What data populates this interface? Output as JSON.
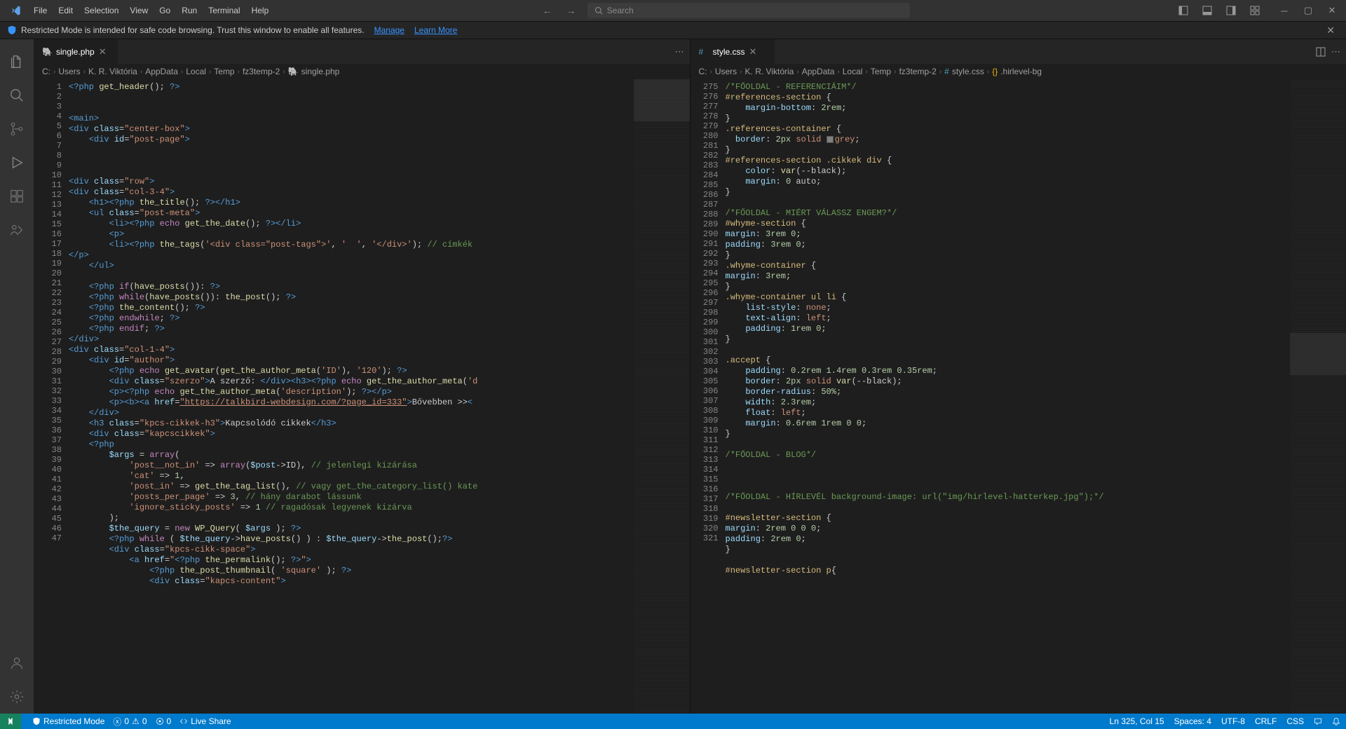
{
  "menubar": [
    "File",
    "Edit",
    "Selection",
    "View",
    "Go",
    "Run",
    "Terminal",
    "Help"
  ],
  "search_placeholder": "Search",
  "notif": {
    "text": "Restricted Mode is intended for safe code browsing. Trust this window to enable all features.",
    "manage": "Manage",
    "learn": "Learn More"
  },
  "tabs": {
    "left": {
      "name": "single.php"
    },
    "right": {
      "name": "style.css"
    }
  },
  "breadcrumbs_left": [
    "C:",
    "Users",
    "K. R. Viktória",
    "AppData",
    "Local",
    "Temp",
    "fz3temp-2",
    "single.php"
  ],
  "breadcrumbs_right": [
    "C:",
    "Users",
    "K. R. Viktória",
    "AppData",
    "Local",
    "Temp",
    "fz3temp-2",
    "style.css",
    ".hirlevel-bg"
  ],
  "left_lines_start": 1,
  "left_lines_end": 47,
  "right_lines_start": 275,
  "right_lines_end": 321,
  "statusbar": {
    "restricted": "Restricted Mode",
    "errors": "0",
    "warnings": "0",
    "ports": "0",
    "liveshare": "Live Share",
    "lncol": "Ln 325, Col 15",
    "spaces": "Spaces: 4",
    "encoding": "UTF-8",
    "eol": "CRLF",
    "lang": "CSS"
  },
  "left_code_html": "<span class='tk-tag'>&lt;?php</span> <span class='tk-fn'>get_header</span>(); <span class='tk-tag'>?&gt;</span>\n\n\n<span class='tk-tag'>&lt;main&gt;</span>\n<span class='tk-tag'>&lt;div</span> <span class='tk-attr'>class</span>=<span class='tk-str'>\"center-box\"</span><span class='tk-tag'>&gt;</span>\n    <span class='tk-tag'>&lt;div</span> <span class='tk-attr'>id</span>=<span class='tk-str'>\"post-page\"</span><span class='tk-tag'>&gt;</span>\n\n\n\n<span class='tk-tag'>&lt;div</span> <span class='tk-attr'>class</span>=<span class='tk-str'>\"row\"</span><span class='tk-tag'>&gt;</span>\n<span class='tk-tag'>&lt;div</span> <span class='tk-attr'>class</span>=<span class='tk-str'>\"col-3-4\"</span><span class='tk-tag'>&gt;</span>\n    <span class='tk-tag'>&lt;h1&gt;&lt;?php</span> <span class='tk-fn'>the_title</span>(); <span class='tk-tag'>?&gt;&lt;/h1&gt;</span>\n    <span class='tk-tag'>&lt;ul</span> <span class='tk-attr'>class</span>=<span class='tk-str'>\"post-meta\"</span><span class='tk-tag'>&gt;</span>\n        <span class='tk-tag'>&lt;li&gt;&lt;?php</span> <span class='tk-kw'>echo</span> <span class='tk-fn'>get_the_date</span>(); <span class='tk-tag'>?&gt;&lt;/li&gt;</span>\n        <span class='tk-tag'>&lt;p&gt;</span>\n        <span class='tk-tag'>&lt;li&gt;&lt;?php</span> <span class='tk-fn'>the_tags</span>(<span class='tk-str'>'&lt;div class=\"post-tags\"&gt;'</span>, <span class='tk-str'>'  '</span>, <span class='tk-str'>'&lt;/div&gt;'</span>); <span class='tk-com'>// címkék</span>\n<span class='tk-tag'>&lt;/p&gt;</span>\n    <span class='tk-tag'>&lt;/ul&gt;</span>\n\n    <span class='tk-tag'>&lt;?php</span> <span class='tk-kw'>if</span>(<span class='tk-fn'>have_posts</span>()): <span class='tk-tag'>?&gt;</span>\n    <span class='tk-tag'>&lt;?php</span> <span class='tk-kw'>while</span>(<span class='tk-fn'>have_posts</span>()): <span class='tk-fn'>the_post</span>(); <span class='tk-tag'>?&gt;</span>\n    <span class='tk-tag'>&lt;?php</span> <span class='tk-fn'>the_content</span>(); <span class='tk-tag'>?&gt;</span>\n    <span class='tk-tag'>&lt;?php</span> <span class='tk-kw'>endwhile</span>; <span class='tk-tag'>?&gt;</span>\n    <span class='tk-tag'>&lt;?php</span> <span class='tk-kw'>endif</span>; <span class='tk-tag'>?&gt;</span>\n<span class='tk-tag'>&lt;/div&gt;</span>\n<span class='tk-tag'>&lt;div</span> <span class='tk-attr'>class</span>=<span class='tk-str'>\"col-1-4\"</span><span class='tk-tag'>&gt;</span>\n    <span class='tk-tag'>&lt;div</span> <span class='tk-attr'>id</span>=<span class='tk-str'>\"author\"</span><span class='tk-tag'>&gt;</span>\n        <span class='tk-tag'>&lt;?php</span> <span class='tk-kw'>echo</span> <span class='tk-fn'>get_avatar</span>(<span class='tk-fn'>get_the_author_meta</span>(<span class='tk-str'>'ID'</span>), <span class='tk-str'>'120'</span>); <span class='tk-tag'>?&gt;</span>\n        <span class='tk-tag'>&lt;div</span> <span class='tk-attr'>class</span>=<span class='tk-str'>\"szerzo\"</span><span class='tk-tag'>&gt;</span>A szerző: <span class='tk-tag'>&lt;/div&gt;&lt;h3&gt;&lt;?php</span> <span class='tk-kw'>echo</span> <span class='tk-fn'>get_the_author_meta</span>(<span class='tk-str'>'d</span>\n        <span class='tk-tag'>&lt;p&gt;&lt;?php</span> <span class='tk-kw'>echo</span> <span class='tk-fn'>get_the_author_meta</span>(<span class='tk-str'>'description'</span>); <span class='tk-tag'>?&gt;&lt;/p&gt;</span>\n        <span class='tk-tag'>&lt;p&gt;&lt;b&gt;&lt;a</span> <span class='tk-attr'>href</span>=<span class='tk-str link-underline'>\"https://talkbird-webdesign.com/?page_id=333\"</span><span class='tk-tag'>&gt;</span>Bővebben &gt;&gt;<span class='tk-tag'>&lt;</span>\n    <span class='tk-tag'>&lt;/div&gt;</span>\n    <span class='tk-tag'>&lt;h3</span> <span class='tk-attr'>class</span>=<span class='tk-str'>\"kpcs-cikkek-h3\"</span><span class='tk-tag'>&gt;</span>Kapcsolódó cikkek<span class='tk-tag'>&lt;/h3&gt;</span>\n    <span class='tk-tag'>&lt;div</span> <span class='tk-attr'>class</span>=<span class='tk-str'>\"kapcscikkek\"</span><span class='tk-tag'>&gt;</span>\n    <span class='tk-tag'>&lt;?php</span>\n        <span class='tk-var'>$args</span> = <span class='tk-kw'>array</span>(\n            <span class='tk-str'>'post__not_in'</span> =&gt; <span class='tk-kw'>array</span>(<span class='tk-var'>$post</span>-&gt;ID), <span class='tk-com'>// jelenlegi kizárása</span>\n            <span class='tk-str'>'cat'</span> =&gt; <span class='tk-num'>1</span>,\n            <span class='tk-str'>'post_in'</span> =&gt; <span class='tk-fn'>get_the_tag_list</span>(), <span class='tk-com'>// vagy get_the_category_list() kate</span>\n            <span class='tk-str'>'posts_per_page'</span> =&gt; <span class='tk-num'>3</span>, <span class='tk-com'>// hány darabot lássunk</span>\n            <span class='tk-str'>'ignore_sticky_posts'</span> =&gt; <span class='tk-num'>1</span> <span class='tk-com'>// ragadósak legyenek kizárva</span>\n        );\n        <span class='tk-var'>$the_query</span> = <span class='tk-kw'>new</span> <span class='tk-fn'>WP_Query</span>( <span class='tk-var'>$args</span> ); <span class='tk-tag'>?&gt;</span>\n        <span class='tk-tag'>&lt;?php</span> <span class='tk-kw'>while</span> ( <span class='tk-var'>$the_query</span>-&gt;<span class='tk-fn'>have_posts</span>() ) : <span class='tk-var'>$the_query</span>-&gt;<span class='tk-fn'>the_post</span>();<span class='tk-tag'>?&gt;</span>\n        <span class='tk-tag'>&lt;div</span> <span class='tk-attr'>class</span>=<span class='tk-str'>\"kpcs-cikk-space\"</span><span class='tk-tag'>&gt;</span>\n            <span class='tk-tag'>&lt;a</span> <span class='tk-attr'>href</span>=<span class='tk-str'>\"</span><span class='tk-tag'>&lt;?php</span> <span class='tk-fn'>the_permalink</span>(); <span class='tk-tag'>?&gt;</span><span class='tk-str'>\"</span><span class='tk-tag'>&gt;</span>\n                <span class='tk-tag'>&lt;?php</span> <span class='tk-fn'>the_post_thumbnail</span>( <span class='tk-str'>'square'</span> ); <span class='tk-tag'>?&gt;</span>\n                <span class='tk-tag'>&lt;div</span> <span class='tk-attr'>class</span>=<span class='tk-str'>\"kapcs-content\"</span><span class='tk-tag'>&gt;</span>",
  "right_code_html": "<span class='tk-com'>/*FŐOLDAL - REFERENCIÁIM*/</span>\n<span class='tk-sel'>#references-section</span> {\n    <span class='tk-prop'>margin-bottom</span>: <span class='tk-num'>2rem</span>;\n}\n<span class='tk-sel'>.references-container</span> {\n  <span class='tk-prop'>border</span>: <span class='tk-num'>2px</span> <span class='tk-str'>solid</span> <span class='colorbox'></span><span class='tk-str'>grey</span>;\n}\n<span class='tk-sel'>#references-section .cikkek div</span> {\n    <span class='tk-prop'>color</span>: <span class='tk-cssfn'>var</span>(--black);\n    <span class='tk-prop'>margin</span>: <span class='tk-num'>0</span> auto;\n}\n\n<span class='tk-com'>/*FŐOLDAL - MIÉRT VÁLASSZ ENGEM?*/</span>\n<span class='tk-sel'>#whyme-section</span> {\n<span class='tk-prop'>margin</span>: <span class='tk-num'>3rem 0</span>;\n<span class='tk-prop'>padding</span>: <span class='tk-num'>3rem 0</span>;\n}\n<span class='tk-sel'>.whyme-container</span> {\n<span class='tk-prop'>margin</span>: <span class='tk-num'>3rem</span>;\n}\n<span class='tk-sel'>.whyme-container ul li</span> {\n    <span class='tk-prop'>list-style</span>: <span class='tk-str'>none</span>;\n    <span class='tk-prop'>text-align</span>: <span class='tk-str'>left</span>;\n    <span class='tk-prop'>padding</span>: <span class='tk-num'>1rem 0</span>;\n}\n\n<span class='tk-sel'>.accept</span> {\n    <span class='tk-prop'>padding</span>: <span class='tk-num'>0.2rem 1.4rem 0.3rem 0.35rem</span>;\n    <span class='tk-prop'>border</span>: <span class='tk-num'>2px</span> <span class='tk-str'>solid</span> <span class='tk-cssfn'>var</span>(--black);\n    <span class='tk-prop'>border-radius</span>: <span class='tk-num'>50%</span>;\n    <span class='tk-prop'>width</span>: <span class='tk-num'>2.3rem</span>;\n    <span class='tk-prop'>float</span>: <span class='tk-str'>left</span>;\n    <span class='tk-prop'>margin</span>: <span class='tk-num'>0.6rem 1rem 0 0</span>;\n}\n\n<span class='tk-com'>/*FŐOLDAL - BLOG*/</span>\n\n\n\n<span class='tk-com'>/*FŐOLDAL - HÍRLEVÉL background-image: url(\"img/hirlevel-hatterkep.jpg\");*/</span>\n\n<span class='tk-sel'>#newsletter-section</span> {\n<span class='tk-prop'>margin</span>: <span class='tk-num'>2rem 0 0 0</span>;\n<span class='tk-prop'>padding</span>: <span class='tk-num'>2rem 0</span>;\n}\n\n<span class='tk-sel'>#newsletter-section p</span>{"
}
